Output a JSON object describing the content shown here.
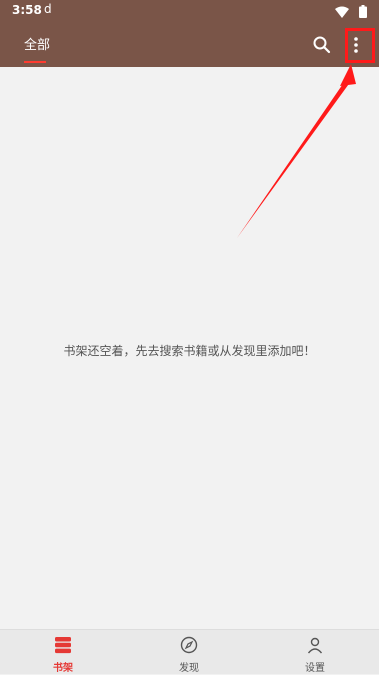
{
  "status_bar": {
    "time": "3:58",
    "app_indicator": "d"
  },
  "toolbar": {
    "tabs": [
      {
        "label": "全部",
        "selected": true
      }
    ],
    "search_icon": "search-icon",
    "more_icon": "more-vert-icon"
  },
  "main": {
    "empty_message": "书架还空着，先去搜索书籍或从发现里添加吧！"
  },
  "bottom_nav": {
    "items": [
      {
        "label": "书架",
        "icon": "bookshelf-icon",
        "active": true
      },
      {
        "label": "发现",
        "icon": "compass-icon",
        "active": false
      },
      {
        "label": "设置",
        "icon": "person-icon",
        "active": false
      }
    ]
  },
  "colors": {
    "toolbar": "#7a5548",
    "accent": "#e53935",
    "highlight": "#ff1a1a"
  }
}
